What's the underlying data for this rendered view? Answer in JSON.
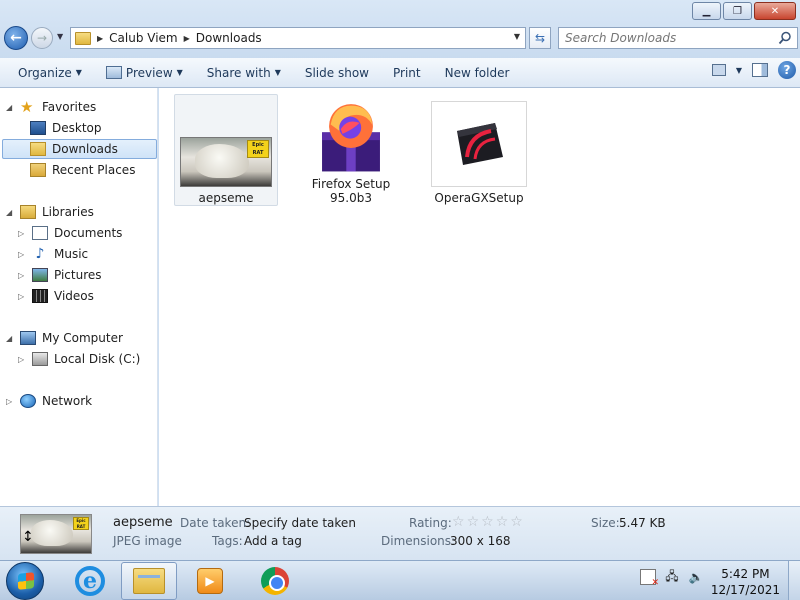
{
  "window": {
    "minimize_icon": "minimize-icon",
    "restore_icon": "restore-icon",
    "close_icon": "close-icon"
  },
  "address": {
    "crumbs": [
      "Calub Viem",
      "Downloads"
    ],
    "search_placeholder": "Search Downloads"
  },
  "toolbar": {
    "organize": "Organize",
    "preview": "Preview",
    "share_with": "Share with",
    "slide_show": "Slide show",
    "print": "Print",
    "new_folder": "New folder"
  },
  "sidebar": {
    "favorites": "Favorites",
    "desktop": "Desktop",
    "downloads": "Downloads",
    "recent_places": "Recent Places",
    "libraries": "Libraries",
    "documents": "Documents",
    "music": "Music",
    "pictures": "Pictures",
    "videos": "Videos",
    "my_computer": "My Computer",
    "local_disk": "Local Disk (C:)",
    "network": "Network"
  },
  "files": [
    {
      "name": "aepseme",
      "badge": "Epic RAT"
    },
    {
      "name_line1": "Firefox Setup",
      "name_line2": "95.0b3"
    },
    {
      "name": "OperaGXSetup"
    }
  ],
  "details": {
    "filename": "aepseme",
    "filetype": "JPEG image",
    "date_taken_label": "Date taken:",
    "date_taken_value": "Specify date taken",
    "tags_label": "Tags:",
    "tags_value": "Add a tag",
    "rating_label": "Rating:",
    "dimensions_label": "Dimensions:",
    "dimensions_value": "300 x 168",
    "size_label": "Size:",
    "size_value": "5.47 KB",
    "rating_stars": 0
  },
  "taskbar": {
    "time": "5:42 PM",
    "date": "12/17/2021"
  },
  "colors": {
    "accent": "#1f5eb0",
    "selection": "#cfe3f8"
  }
}
